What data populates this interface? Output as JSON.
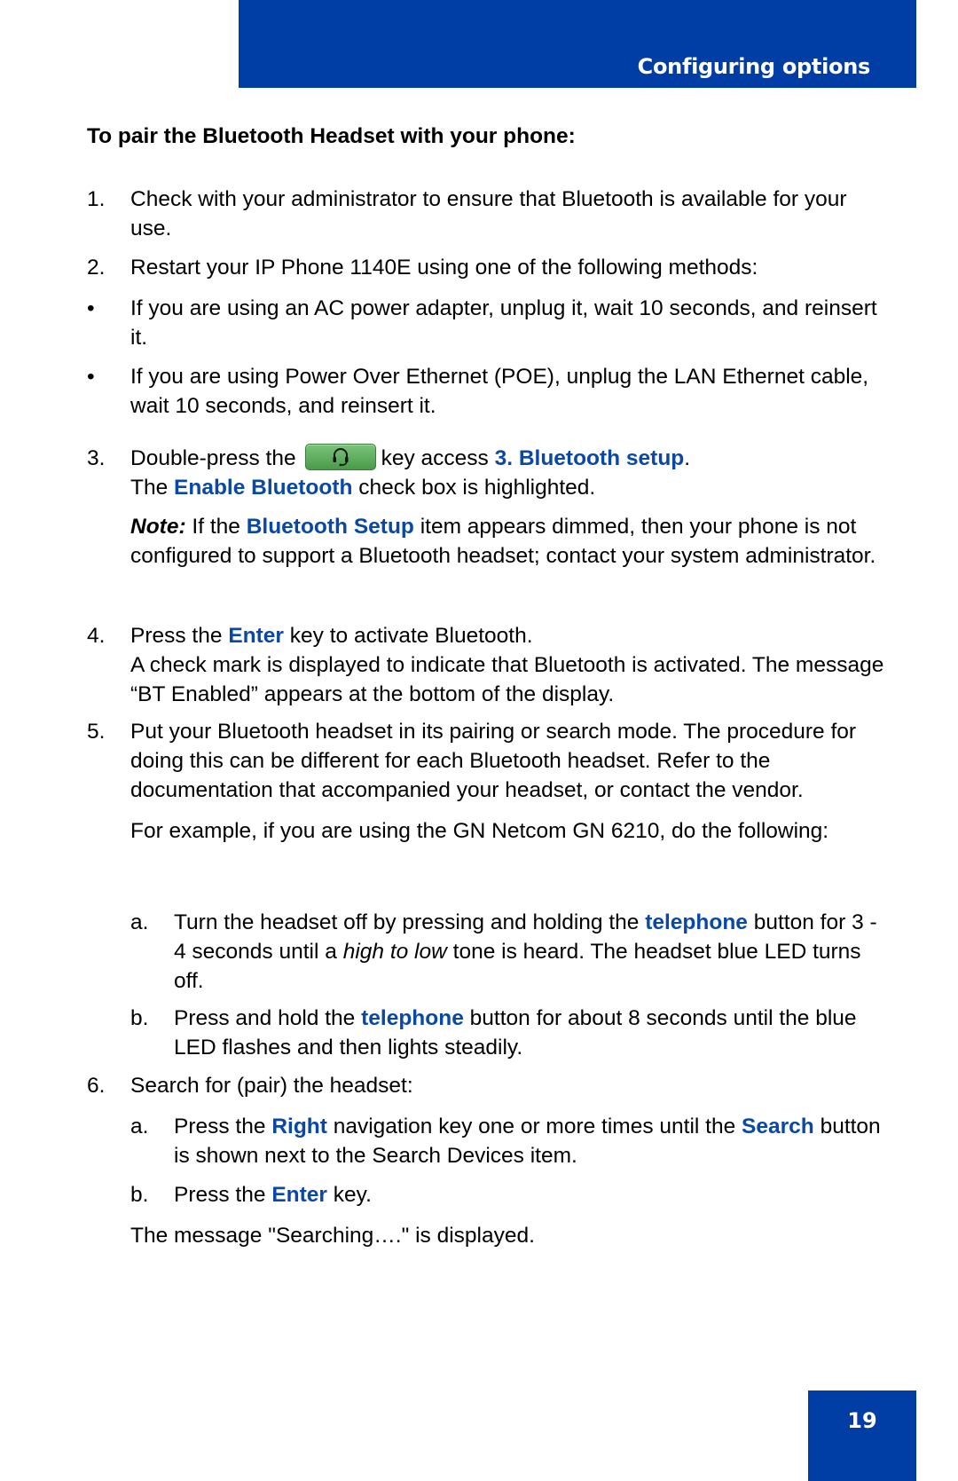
{
  "header": {
    "section_title": "Configuring options"
  },
  "page": {
    "number": "19"
  },
  "heading": "To pair the Bluetooth Headset with your phone:",
  "steps": {
    "s1": {
      "num": "1.",
      "text": "Check with your administrator to ensure that Bluetooth is available for your use."
    },
    "s2": {
      "num": "2.",
      "text": "Restart your IP Phone 1140E using one of the following methods:"
    },
    "b1": {
      "num": "•",
      "text": "If you are using an AC power adapter, unplug it, wait 10 seconds, and reinsert it."
    },
    "b2": {
      "num": "•",
      "text": "If you are using Power Over Ethernet (POE), unplug the LAN Ethernet cable, wait 10 seconds, and reinsert it."
    },
    "s3": {
      "num": "3.",
      "pre": "Double-press the",
      "key_icon": "headset-key-icon",
      "mid": "key access",
      "link1": "3. Bluetooth setup",
      "post1": ".",
      "line2_pre": "The",
      "link2": "Enable Bluetooth",
      "line2_post": "check box is highlighted."
    },
    "note": {
      "label": "Note:",
      "pre": "If the",
      "link": "Bluetooth Setup",
      "post": "item appears dimmed, then your phone is not configured to support a Bluetooth headset; contact your system administrator."
    },
    "s4": {
      "num": "4.",
      "pre": "Press the",
      "link": "Enter",
      "post": "key to activate Bluetooth.",
      "line2": "A check mark is displayed to indicate that Bluetooth is activated. The message “BT Enabled” appears at the bottom of the display."
    },
    "s5": {
      "num": "5.",
      "text": "Put your Bluetooth headset in its pairing or search mode. The procedure for doing this can be different for each Bluetooth headset. Refer to the documentation that accompanied your headset, or contact the vendor.",
      "example": "For example, if you are using the GN Netcom GN 6210, do the following:"
    },
    "s5a": {
      "num": "a.",
      "pre": "Turn the headset off by pressing and holding the",
      "link": "telephone",
      "mid": "button for 3 - 4 seconds until a",
      "italic": "high to low",
      "post": "tone is heard. The headset blue LED turns off."
    },
    "s5b": {
      "num": "b.",
      "pre": "Press and hold the",
      "link": "telephone",
      "post": "button for about 8 seconds until the blue LED flashes and then lights steadily."
    },
    "s6": {
      "num": "6.",
      "text": "Search for (pair) the headset:"
    },
    "s6a": {
      "num": "a.",
      "pre": "Press the",
      "link1": "Right",
      "mid": "navigation key one or more times until the",
      "link2": "Search",
      "post": "button is shown next to the Search Devices item."
    },
    "s6b": {
      "num": "b.",
      "pre": "Press the",
      "link": "Enter",
      "post": "key."
    },
    "final": "The message \"Searching….\" is displayed."
  },
  "colors": {
    "brand_blue": "#003da5",
    "link_blue": "#0a48a8",
    "key_green": "#5aaa5a"
  }
}
